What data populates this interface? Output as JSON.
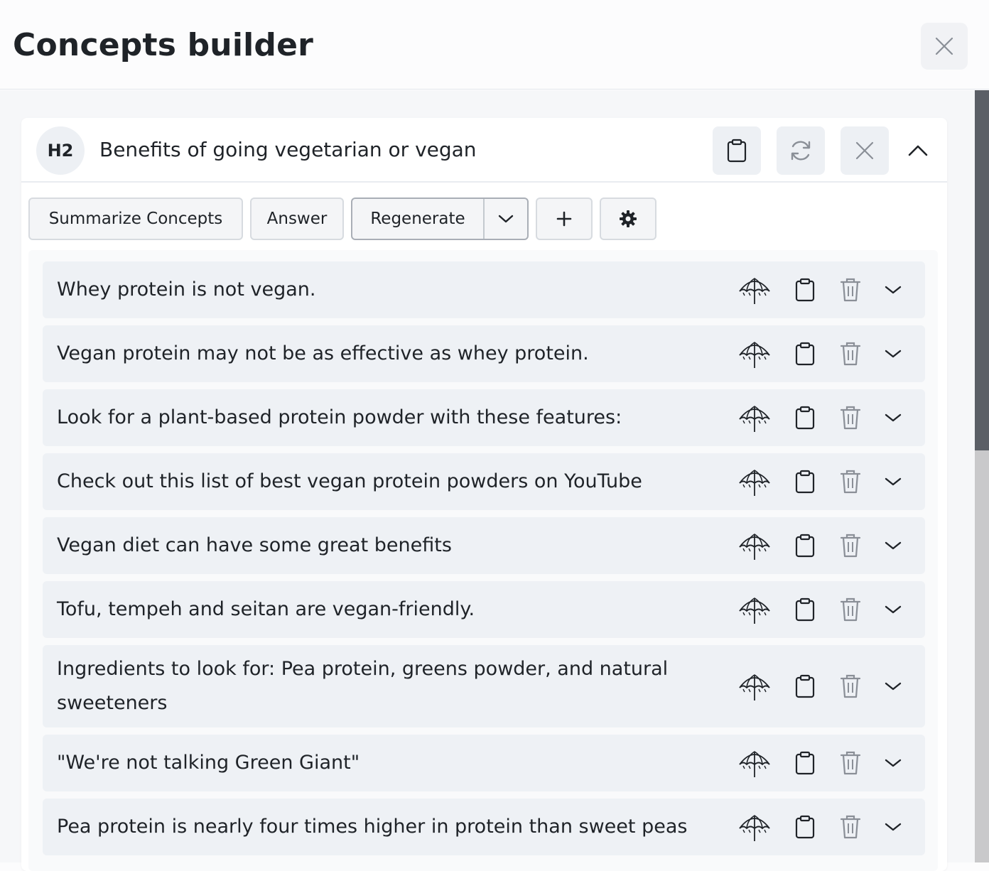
{
  "header": {
    "title": "Concepts builder"
  },
  "section": {
    "level": "H2",
    "title": "Benefits of going vegetarian or vegan"
  },
  "toolbar": {
    "summarize_label": "Summarize Concepts",
    "answer_label": "Answer",
    "regenerate_label": "Regenerate",
    "add_label": "+"
  },
  "concepts": [
    {
      "text": "Whey protein is not vegan."
    },
    {
      "text": "Vegan protein may not be as effective as whey protein."
    },
    {
      "text": "Look for a plant-based protein powder with these features:"
    },
    {
      "text": "Check out this list of best vegan protein powders on YouTube"
    },
    {
      "text": "Vegan diet can have some great benefits"
    },
    {
      "text": "Tofu, tempeh and seitan are vegan-friendly."
    },
    {
      "text": "Ingredients to look for: Pea protein, greens powder, and natural sweeteners"
    },
    {
      "text": "\"We're not talking Green Giant\""
    },
    {
      "text": "Pea protein is nearly four times higher in protein than sweet peas"
    }
  ],
  "icons": {
    "row": [
      "umbrella-icon",
      "clipboard-icon",
      "trash-icon",
      "chevron-down-icon"
    ],
    "header": [
      "clipboard-icon",
      "refresh-icon",
      "close-icon",
      "chevron-up-icon"
    ],
    "toolbar": [
      "plus-icon",
      "gear-icon"
    ]
  },
  "colors": {
    "row_bg": "#eef1f5",
    "button_bg": "#f4f5f7",
    "scrollbar_thumb": "#5b5f66"
  }
}
